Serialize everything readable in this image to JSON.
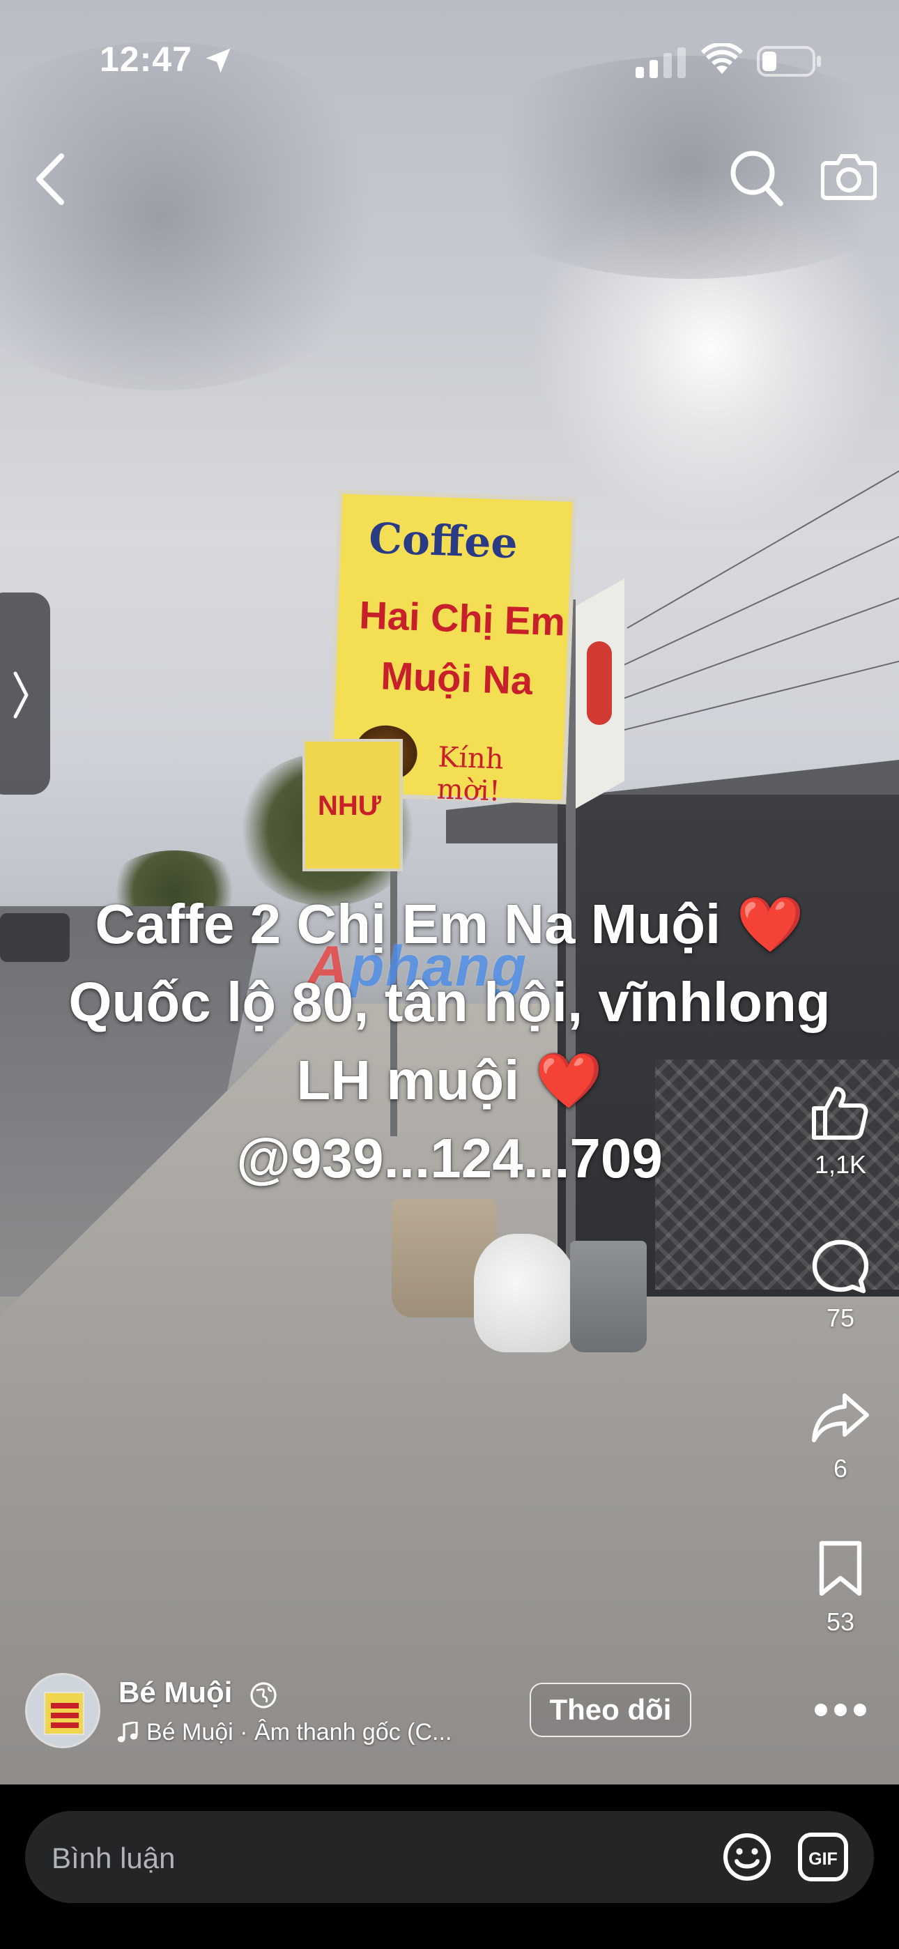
{
  "status_bar": {
    "time": "12:47"
  },
  "video": {
    "sign_text": {
      "line1": "Coffee",
      "line2": "Hai Chị Em",
      "line3": "Muội Na",
      "line4": "Kính mời!",
      "small": "NHƯ"
    },
    "watermark": {
      "part1": "A",
      "part2": "phang"
    },
    "caption": {
      "line1": "Caffe 2 Chị Em Na Muội",
      "line2": "Quốc lộ 80, tân hội, vĩnhlong",
      "line3": "LH muội",
      "line4": "@939...124...709",
      "heart": "❤️"
    }
  },
  "actions": {
    "like": {
      "icon": "thumbs-up-icon",
      "count": "1,1K"
    },
    "comment": {
      "icon": "comment-bubble-icon",
      "count": "75"
    },
    "share": {
      "icon": "share-arrow-icon",
      "count": "6"
    },
    "save": {
      "icon": "bookmark-icon",
      "count": "53"
    }
  },
  "post": {
    "author": "Bé Muội",
    "audio": "Bé Muội · Âm thanh gốc (C...",
    "follow_label": "Theo dõi"
  },
  "comment_bar": {
    "placeholder": "Bình luận",
    "gif_label": "GIF"
  }
}
